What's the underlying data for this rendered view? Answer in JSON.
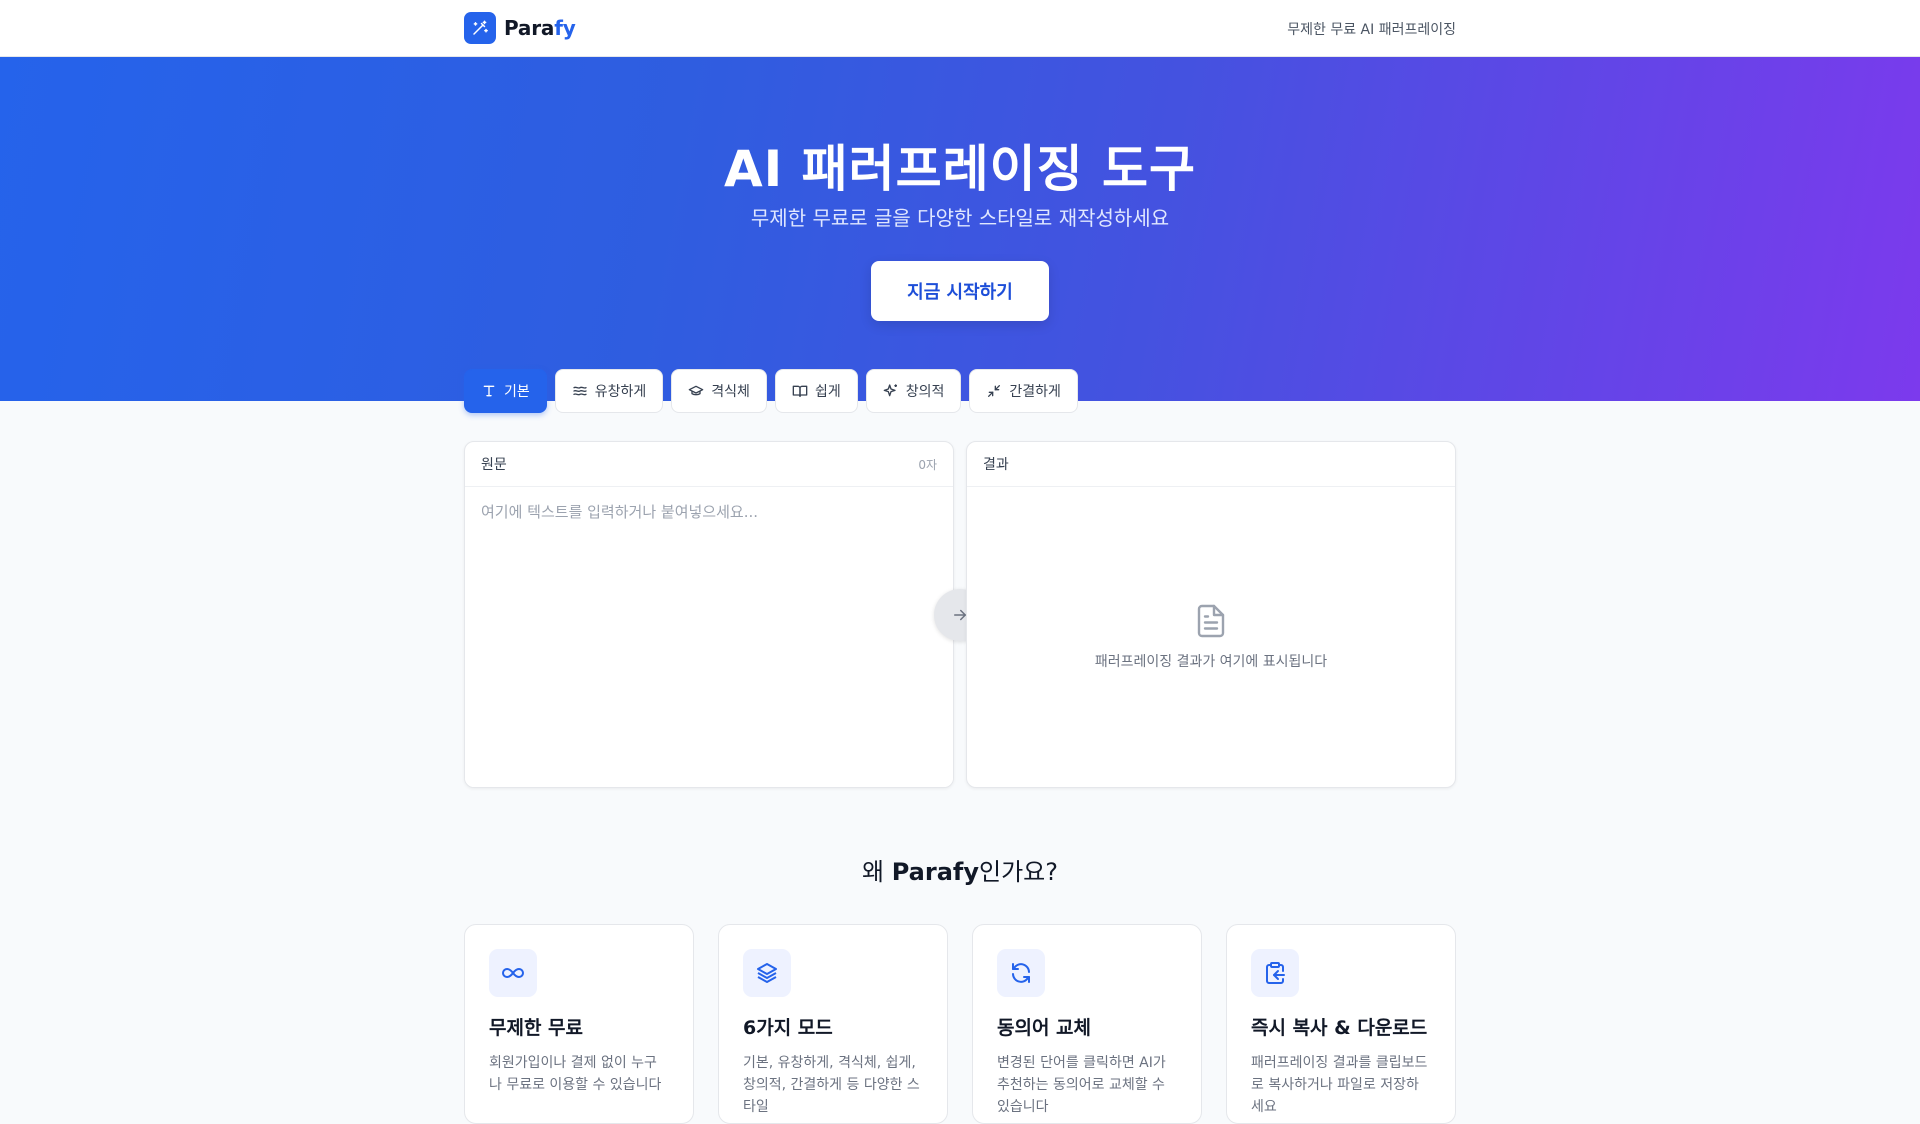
{
  "header": {
    "brand_main": "Para",
    "brand_accent": "fy",
    "tagline": "무제한 무료 AI 패러프레이징"
  },
  "hero": {
    "title": "AI 패러프레이징 도구",
    "subtitle": "무제한 무료로 글을 다양한 스타일로 재작성하세요",
    "cta_label": "지금 시작하기"
  },
  "tabs": [
    {
      "label": "기본",
      "icon": "type-icon",
      "active": true
    },
    {
      "label": "유창하게",
      "icon": "waves-icon",
      "active": false
    },
    {
      "label": "격식체",
      "icon": "graduation-cap-icon",
      "active": false
    },
    {
      "label": "쉽게",
      "icon": "book-open-icon",
      "active": false
    },
    {
      "label": "창의적",
      "icon": "sparkles-icon",
      "active": false
    },
    {
      "label": "간결하게",
      "icon": "minimize-icon",
      "active": false
    }
  ],
  "source_panel": {
    "title": "원문",
    "char_count": "0자",
    "value": "",
    "placeholder": "여기에 텍스트를 입력하거나 붙여넣으세요..."
  },
  "result_panel": {
    "title": "결과",
    "empty_text": "패러프레이징 결과가 여기에 표시됩니다"
  },
  "features": {
    "title_prefix": "왜 ",
    "title_brand": "Parafy",
    "title_suffix": "인가요?",
    "cards": [
      {
        "icon": "infinity-icon",
        "title": "무제한 무료",
        "desc": "회원가입이나 결제 없이 누구나 무료로 이용할 수 있습니다"
      },
      {
        "icon": "layers-icon",
        "title": "6가지 모드",
        "desc": "기본, 유창하게, 격식체, 쉽게, 창의적, 간결하게 등 다양한 스타일"
      },
      {
        "icon": "refresh-icon",
        "title": "동의어 교체",
        "desc": "변경된 단어를 클릭하면 AI가 추천하는 동의어로 교체할 수 있습니다"
      },
      {
        "icon": "clipboard-copy-icon",
        "title": "즉시 복사 & 다운로드",
        "desc": "패러프레이징 결과를 클립보드로 복사하거나 파일로 저장하세요"
      }
    ]
  },
  "colors": {
    "primary": "#2563eb",
    "gradient_end": "#7c3aed",
    "background": "#f8fafc"
  }
}
